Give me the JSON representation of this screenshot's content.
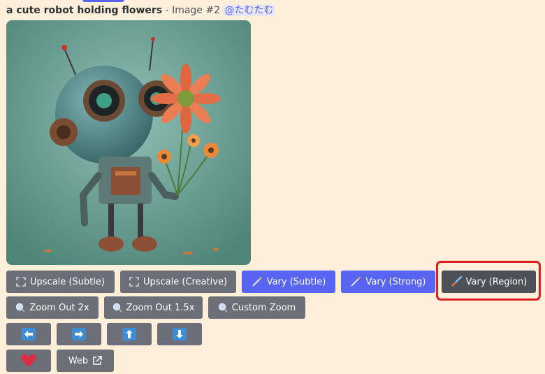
{
  "message": {
    "prompt": "a cute robot holding flowers",
    "separator": " - ",
    "image_label": "Image #2",
    "mention": "@たむたむ"
  },
  "buttons": {
    "row1": [
      {
        "label": "Upscale (Subtle)",
        "icon": "expand-icon"
      },
      {
        "label": "Upscale (Creative)",
        "icon": "expand-icon"
      },
      {
        "label": "Vary (Subtle)",
        "icon": "magic-wand-icon"
      },
      {
        "label": "Vary (Strong)",
        "icon": "magic-wand-icon"
      },
      {
        "label": "Vary (Region)",
        "icon": "paintbrush-icon"
      }
    ],
    "row2": [
      {
        "label": "Zoom Out 2x",
        "icon": "magnifier-icon"
      },
      {
        "label": "Zoom Out 1.5x",
        "icon": "magnifier-icon"
      },
      {
        "label": "Custom Zoom",
        "icon": "magnifier-icon"
      }
    ],
    "row3": [
      {
        "icon": "arrow-left-icon"
      },
      {
        "icon": "arrow-right-icon"
      },
      {
        "icon": "arrow-up-icon"
      },
      {
        "icon": "arrow-down-icon"
      }
    ],
    "row4": [
      {
        "icon": "heart-icon"
      },
      {
        "label": "Web",
        "icon": "external-link-icon"
      }
    ]
  },
  "colors": {
    "background": "#fdefd9",
    "button_gray": "#6d6f78",
    "button_blurple": "#5865f2",
    "button_selected": "#4e5058",
    "highlight": "#dd1f1f",
    "arrow_blue": "#3b8ed6",
    "heart": "#dd2e44"
  }
}
